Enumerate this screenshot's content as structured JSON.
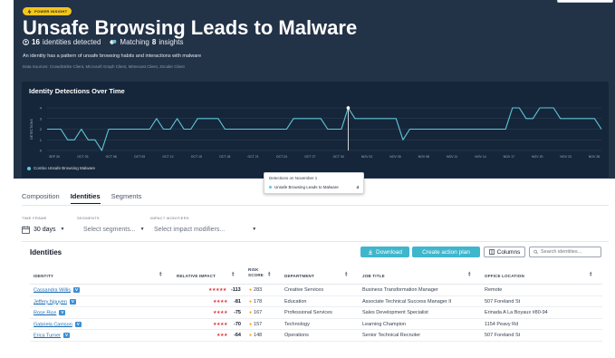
{
  "header": {
    "badge": "POWER INSIGHT",
    "title": "Unsafe Browsing Leads to Malware",
    "identities_count": "16",
    "identities_text": "identities detected",
    "matching_prefix": "Matching",
    "matching_count": "8",
    "matching_suffix": "insights",
    "description": "An identity has a pattern of unsafe browsing habits and interactions with malware",
    "sources": "Data Sources: CrowdStrike Client, Microsoft Graph Client, Mimecast Client, Zscaler Client",
    "colors": {
      "background": "#223247",
      "badge": "#f5c518"
    }
  },
  "chart_data": {
    "type": "line",
    "title": "Identity Detections Over Time",
    "ylabel": "DETECTIONS",
    "ylim": [
      0,
      4
    ],
    "y_ticks": [
      "0",
      "1",
      "2",
      "3",
      "4"
    ],
    "x_labels": [
      "SEP 30",
      "OCT 03",
      "OCT 06",
      "OCT 09",
      "OCT 12",
      "OCT 15",
      "OCT 18",
      "OCT 21",
      "OCT 24",
      "OCT 27",
      "OCT 30",
      "NOV 02",
      "NOV 05",
      "NOV 08",
      "NOV 11",
      "NOV 14",
      "NOV 17",
      "NOV 20",
      "NOV 23",
      "NOV 26"
    ],
    "series": [
      {
        "name": "Combo Unsafe Browsing Malware",
        "color": "#5ec8d8",
        "values": [
          2,
          2,
          2,
          1,
          1,
          2,
          1,
          1,
          0,
          2,
          2,
          2,
          2,
          2,
          2,
          2,
          3,
          2,
          2,
          3,
          2,
          2,
          3,
          3,
          3,
          3,
          2,
          2,
          2,
          2,
          2,
          2,
          2,
          2,
          2,
          2,
          3,
          3,
          3,
          3,
          3,
          2,
          2,
          2,
          4,
          3,
          3,
          3,
          3,
          3,
          3,
          3,
          1,
          2,
          2,
          2,
          2,
          2,
          2,
          2,
          2,
          2,
          2,
          2,
          2,
          2,
          2,
          2,
          4,
          4,
          3,
          3,
          4,
          4,
          4,
          3,
          3,
          3,
          3,
          3,
          3,
          2
        ]
      }
    ],
    "highlight_index": 44,
    "grid": true
  },
  "tooltip": {
    "title": "Detections on November 1",
    "series": "Unsafe Browsing Leads to Malware",
    "value": "4"
  },
  "tabs": [
    "Composition",
    "Identities",
    "Segments"
  ],
  "active_tab": "Identities",
  "filters": {
    "time_frame_label": "TIME FRAME",
    "time_frame_value": "30 days",
    "segments_label": "SEGMENTS",
    "segments_placeholder": "Select segments...",
    "impact_label": "IMPACT MODIFIERS",
    "impact_placeholder": "Select impact modifiers..."
  },
  "card": {
    "title": "Identities",
    "download_label": "Download",
    "action_label": "Create action plan",
    "columns_label": "Columns",
    "search_placeholder": "Search identities...",
    "colors": {
      "primary": "#3fb6cc",
      "link": "#2272b8",
      "risk_dot": "#f59e0b",
      "stars": "#e0353b"
    }
  },
  "table": {
    "headers": {
      "identity": "IDENTITY",
      "relative_impact": "RELATIVE IMPACT",
      "risk_score_1": "RISK",
      "risk_score_2": "SCORE",
      "department": "DEPARTMENT",
      "job_title": "JOB TITLE",
      "office_location": "OFFICE LOCATION"
    },
    "rows": [
      {
        "name": "Cassandra Willis",
        "badge": "V",
        "stars": "★★★★★",
        "impact": "-113",
        "risk": "283",
        "department": "Creative Services",
        "job_title": "Business Transformation Manager",
        "location": "Remote"
      },
      {
        "name": "Jeffery Nguyen",
        "badge": "V",
        "stars": "★★★★",
        "impact": "-81",
        "risk": "178",
        "department": "Education",
        "job_title": "Associate Technical Success Manager II",
        "location": "507 Foreland St"
      },
      {
        "name": "Rose Rice",
        "badge": "V",
        "stars": "★★★★",
        "impact": "-75",
        "risk": "167",
        "department": "Professional Services",
        "job_title": "Sales Development Specialist",
        "location": "Erinada A La Boyaux #80-94"
      },
      {
        "name": "Gabriela Camson",
        "badge": "V",
        "stars": "★★★★",
        "impact": "-70",
        "risk": "157",
        "department": "Technology",
        "job_title": "Learning Champion",
        "location": "1154 Peavy Rd"
      },
      {
        "name": "Erica Turner",
        "badge": "V",
        "stars": "★★★",
        "impact": "-64",
        "risk": "148",
        "department": "Operations",
        "job_title": "Senior Technical Recruiter",
        "location": "507 Foreland St"
      }
    ]
  }
}
